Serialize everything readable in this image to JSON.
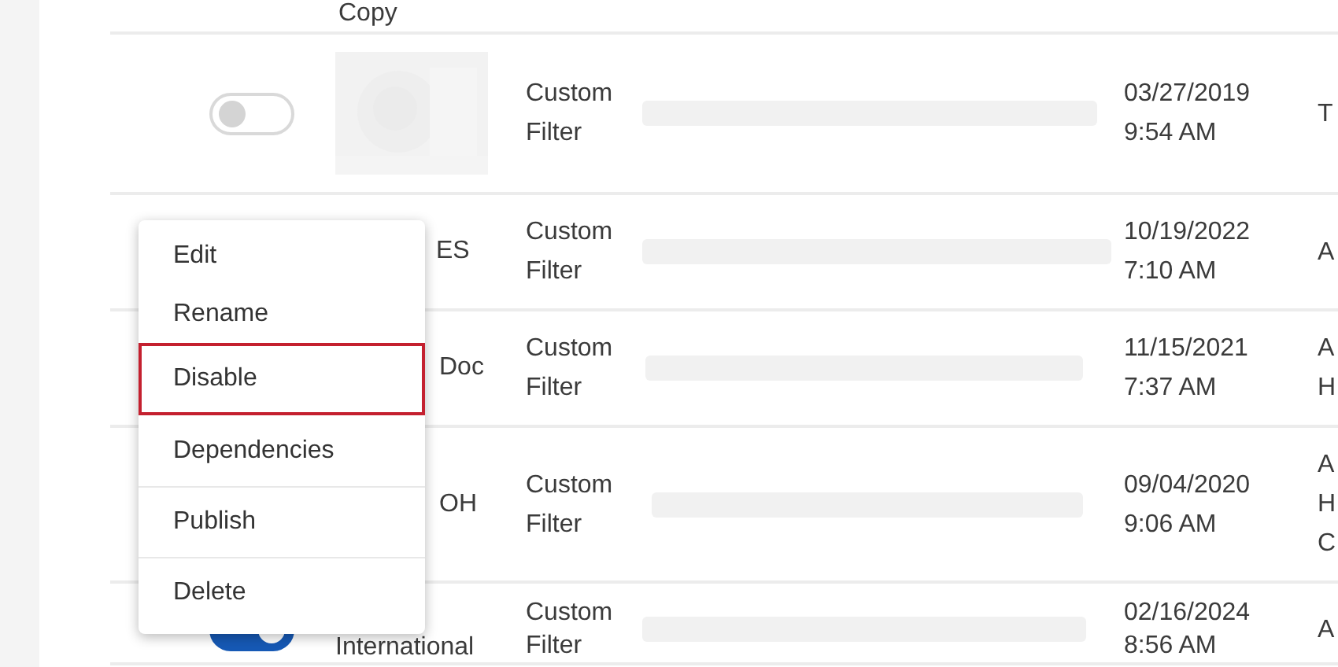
{
  "header_fragment": "Copy",
  "rows": [
    {
      "toggle": {
        "on": false
      },
      "thumbnail": {
        "kind": "picture"
      },
      "name": "",
      "type": [
        "Custom",
        "Filter"
      ],
      "date": [
        "03/27/2019",
        "9:54 AM"
      ],
      "column_6": [
        "T"
      ]
    },
    {
      "name": "ES",
      "type": [
        "Custom",
        "Filter"
      ],
      "date": [
        "10/19/2022",
        "7:10 AM"
      ],
      "column_6": [
        "A"
      ]
    },
    {
      "name": "Doc",
      "type": [
        "Custom",
        "Filter"
      ],
      "date": [
        "11/15/2021",
        "7:37 AM"
      ],
      "column_6": [
        "A",
        "H"
      ]
    },
    {
      "name": "OH",
      "type": [
        "Custom",
        "Filter"
      ],
      "date": [
        "09/04/2020",
        "9:06 AM"
      ],
      "column_6": [
        "A",
        "H",
        "C"
      ]
    },
    {
      "toggle": {
        "on": true
      },
      "name": "International",
      "type": [
        "Custom",
        "Filter"
      ],
      "date": [
        "02/16/2024",
        "8:56 AM"
      ],
      "column_6": [
        "A"
      ]
    }
  ],
  "context_menu": [
    {
      "label": "Edit",
      "highlighted": false,
      "divider": false
    },
    {
      "label": "Rename",
      "highlighted": false,
      "divider": false
    },
    {
      "label": "Disable",
      "highlighted": true,
      "divider": false
    },
    {
      "label": "Dependencies",
      "highlighted": false,
      "divider": false
    },
    {
      "label": "Publish",
      "highlighted": false,
      "divider": true
    },
    {
      "label": "Delete",
      "highlighted": false,
      "divider": true
    }
  ]
}
